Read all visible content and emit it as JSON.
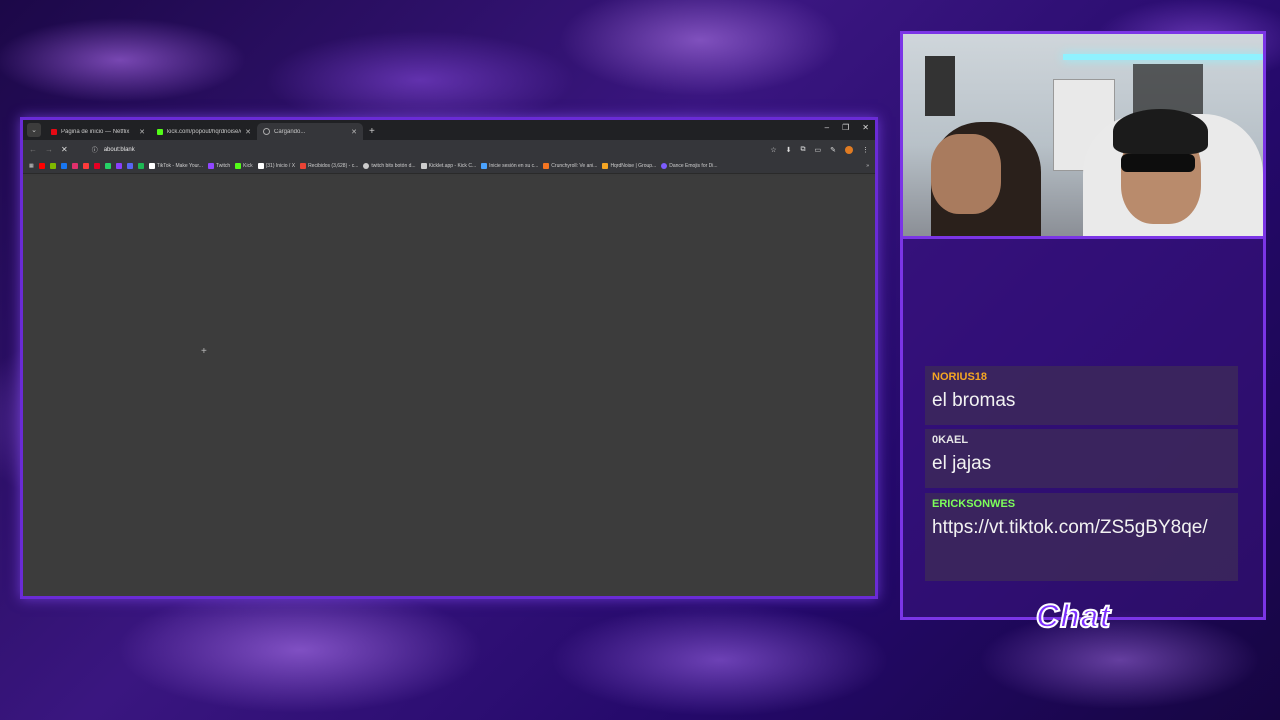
{
  "browser": {
    "tabs": [
      {
        "title": "Página de inicio — Netflix",
        "favicon_color": "#e50914",
        "active": false
      },
      {
        "title": "kick.com/popout/hqrdnoise/ch",
        "favicon_color": "#53fc18",
        "active": false
      },
      {
        "title": "Cargando...",
        "favicon_color": "#aaaaaa",
        "active": true
      }
    ],
    "address": "about:blank",
    "bookmarks": [
      {
        "label": "TikTok - Make Your...",
        "color": "#ffffff"
      },
      {
        "label": "Twitch",
        "color": "#9146ff"
      },
      {
        "label": "Kick",
        "color": "#53fc18"
      },
      {
        "label": "(31) Inicio / X",
        "color": "#ffffff"
      },
      {
        "label": "Recibidos (3,628) - c...",
        "color": "#ea4335"
      },
      {
        "label": "twitch bits botón d...",
        "color": "#cccccc"
      },
      {
        "label": "Kicklet.app - Kick C...",
        "color": "#cccccc"
      },
      {
        "label": "Inicie sesión en su c...",
        "color": "#4aa3ff"
      },
      {
        "label": "Crunchyroll: Ve ani...",
        "color": "#f47521"
      },
      {
        "label": "HqrdNoise | Group...",
        "color": "#f5a623"
      },
      {
        "label": "Dance Emojis for Di...",
        "color": "#7c5cff"
      }
    ]
  },
  "chat": {
    "title": "Chat",
    "messages": [
      {
        "user": "NORIUS18",
        "user_color": "#f5a623",
        "text": "el bromas"
      },
      {
        "user": "0KAEL",
        "user_color": "#e6e6e6",
        "text": "el jajas"
      },
      {
        "user": "ERICKSONWES",
        "user_color": "#7dff5a",
        "text": "https://vt.tiktok.com/ZS5gBY8qe/"
      }
    ]
  }
}
